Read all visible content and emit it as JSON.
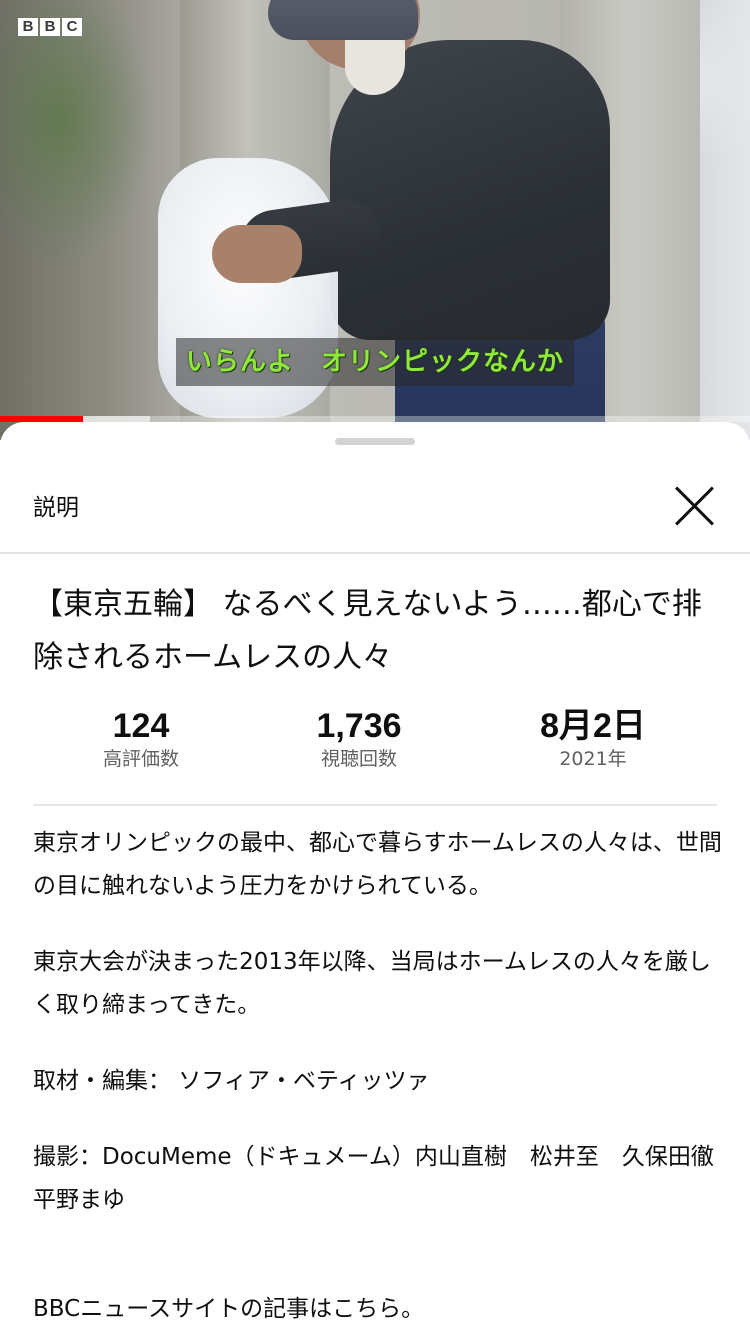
{
  "video": {
    "channel_logo_letters": [
      "B",
      "B",
      "C"
    ],
    "subtitle": "いらんよ　オリンピックなんか",
    "progress_played": 0.11,
    "progress_buffered": 0.2,
    "colors": {
      "progress": "#ff0000",
      "subtitle": "#8fe83a"
    }
  },
  "sheet": {
    "header_title": "説明",
    "close_icon": "close-icon",
    "video_title": "【東京五輪】 なるべく見えないよう……都心で排除されるホームレスの人々",
    "stats": [
      {
        "value": "124",
        "label": "高評価数"
      },
      {
        "value": "1,736",
        "label": "視聴回数"
      },
      {
        "value": "8月2日",
        "label": "2021年"
      }
    ],
    "description": [
      "東京オリンピックの最中、都心で暮らすホームレスの人々は、世間の目に触れないよう圧力をかけられている。",
      "東京大会が決まった2013年以降、当局はホームレスの人々を厳しく取り締まってきた。",
      "取材・編集： ソフィア・ベティッツァ",
      "撮影：DocuMeme（ドキュメーム）内山直樹　松井至　久保田徹　平野まゆ",
      "BBCニュースサイトの記事はこちら。"
    ]
  }
}
